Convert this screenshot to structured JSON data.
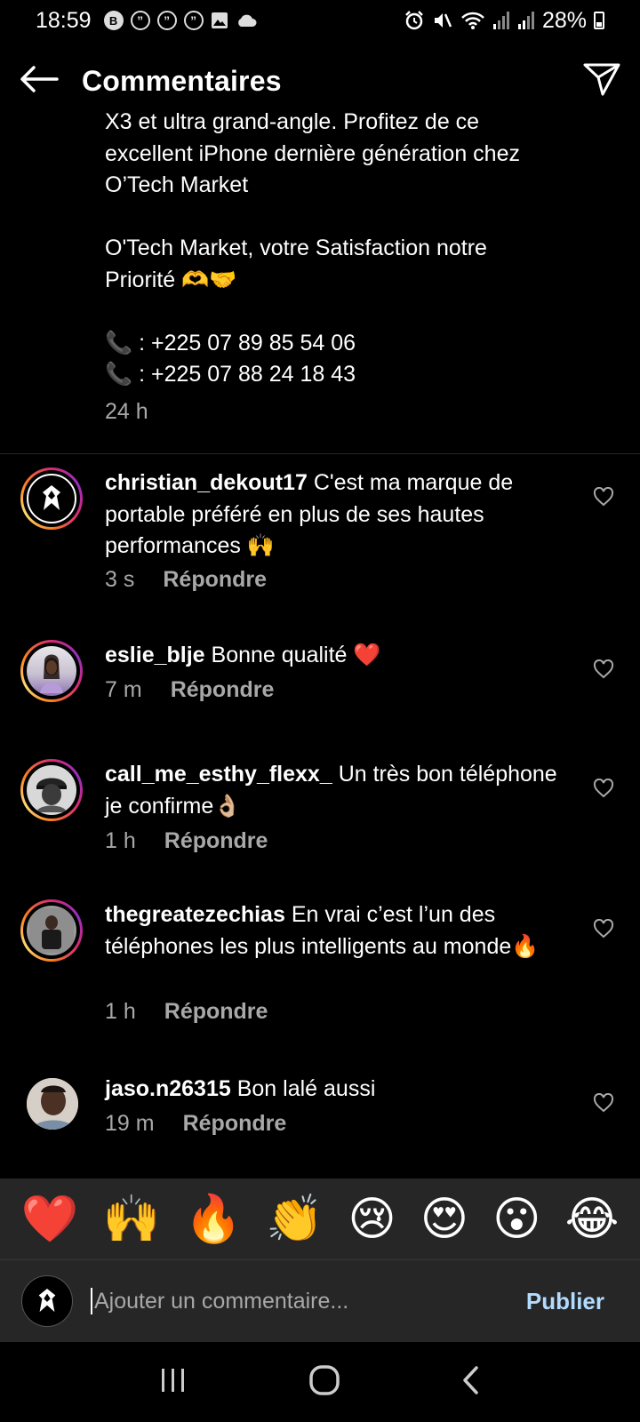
{
  "status_bar": {
    "time": "18:59",
    "battery": "28%",
    "notification_icons": [
      "bible-app-icon",
      "quote-bubble-icon",
      "quote-bubble-icon",
      "quote-bubble-icon",
      "gallery-icon",
      "cloud-icon"
    ],
    "right_icons": [
      "alarm-icon",
      "mute-icon",
      "wifi-icon",
      "signal-icon",
      "signal-icon"
    ]
  },
  "header": {
    "title": "Commentaires",
    "back_icon": "back-arrow-icon",
    "share_icon": "send-icon"
  },
  "caption": {
    "lines": [
      "X3 et ultra grand-angle. Profitez de ce",
      "excellent iPhone dernière génération chez",
      "O’Tech Market",
      "",
      "O'Tech Market, votre Satisfaction notre",
      "Priorité 🫶🤝",
      "",
      "📞 : +225 07 89 85 54 06",
      "📞 : +225 07 88 24 18 43"
    ],
    "time": "24 h"
  },
  "comments": [
    {
      "username": "christian_dekout17",
      "text": "C'est ma marque de portable préféré en plus de ses hautes performances 🙌",
      "time": "3 s",
      "reply": "Répondre",
      "story_ring": true
    },
    {
      "username": "eslie_blje",
      "text": "Bonne qualité ❤️",
      "time": "7 m",
      "reply": "Répondre",
      "story_ring": true
    },
    {
      "username": "call_me_esthy_flexx_",
      "text": "Un très bon téléphone je confirme👌🏼",
      "time": "1 h",
      "reply": "Répondre",
      "story_ring": true
    },
    {
      "username": "thegreatezechias",
      "text": "En vrai c’est l’un des téléphones les plus intelligents au monde🔥",
      "time": "1 h",
      "reply": "Répondre",
      "story_ring": true
    },
    {
      "username": "jaso.n26315",
      "text": "Bon lalé aussi",
      "time": "19 m",
      "reply": "Répondre",
      "story_ring": false
    }
  ],
  "emoji_bar": [
    "❤️",
    "🙌",
    "🔥",
    "👏",
    "😢",
    "😍",
    "😮",
    "😂"
  ],
  "input": {
    "placeholder": "Ajouter un commentaire...",
    "publish": "Publier"
  },
  "nav_bar": [
    "recent-apps-icon",
    "home-icon",
    "back-icon"
  ],
  "colors": {
    "background": "#000000",
    "secondary_text": "#a8a8a8",
    "panel": "#262626",
    "publish": "#b3dbff",
    "heart_emoji": "#e0245e"
  }
}
